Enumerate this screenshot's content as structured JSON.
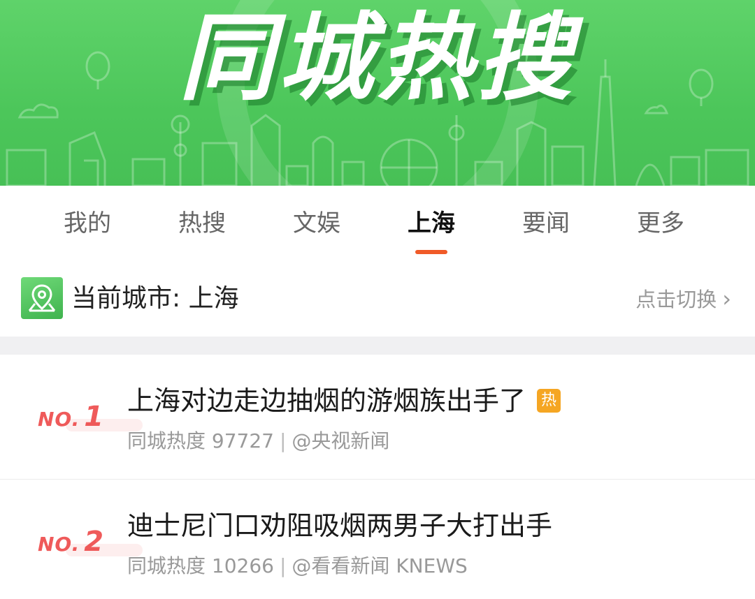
{
  "banner": {
    "title": "同城热搜"
  },
  "tabs": [
    {
      "label": "我的",
      "active": false
    },
    {
      "label": "热搜",
      "active": false
    },
    {
      "label": "文娱",
      "active": false
    },
    {
      "label": "上海",
      "active": true
    },
    {
      "label": "要闻",
      "active": false
    },
    {
      "label": "更多",
      "active": false
    }
  ],
  "city": {
    "label": "当前城市: 上海",
    "switch_label": "点击切换",
    "icon": "location-pin-icon"
  },
  "list": [
    {
      "rank_prefix": "NO.",
      "rank": "1",
      "title": "上海对边走边抽烟的游烟族出手了",
      "badge": "热",
      "heat": "同城热度 97727",
      "separator": "|",
      "source": "@央视新闻"
    },
    {
      "rank_prefix": "NO.",
      "rank": "2",
      "title": "迪士尼门口劝阻吸烟两男子大打出手",
      "badge": "",
      "heat": "同城热度 10266",
      "separator": "|",
      "source": "@看看新闻 KNEWS"
    }
  ],
  "colors": {
    "banner_green": "#4cc65a",
    "tab_underline": "#f05a28",
    "rank_red": "#ef5a5a",
    "hot_badge": "#f5a623"
  }
}
